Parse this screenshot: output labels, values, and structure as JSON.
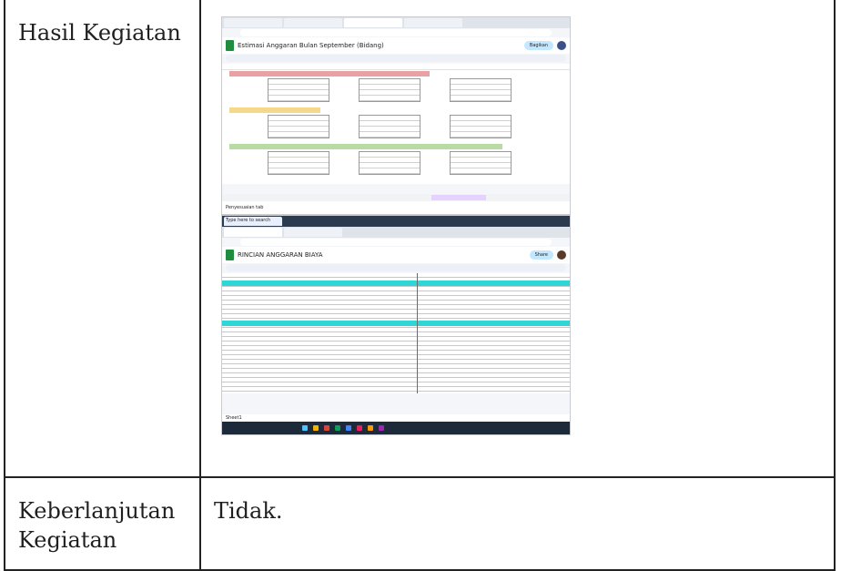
{
  "rows": [
    {
      "label": "Hasil Kegiatan",
      "content": ""
    },
    {
      "label": "Keberlanjutan Kegiatan",
      "content": "Tidak."
    }
  ],
  "screenshot_top": {
    "doc_title": "Estimasi Anggaran Bulan September (Bidang)",
    "share_label": "Bagikan",
    "status_text": "Penyesuaian tab",
    "band_colors": [
      "#e9a1a1",
      "#f6d88a",
      "#b7dba3"
    ]
  },
  "screenshot_bottom": {
    "taskbar_search": "Type here to search",
    "doc_title": "RINCIAN ANGGARAN BIAYA",
    "share_label": "Share",
    "sheet_tab": "Sheet1",
    "band_color": "#2fd6d6"
  }
}
